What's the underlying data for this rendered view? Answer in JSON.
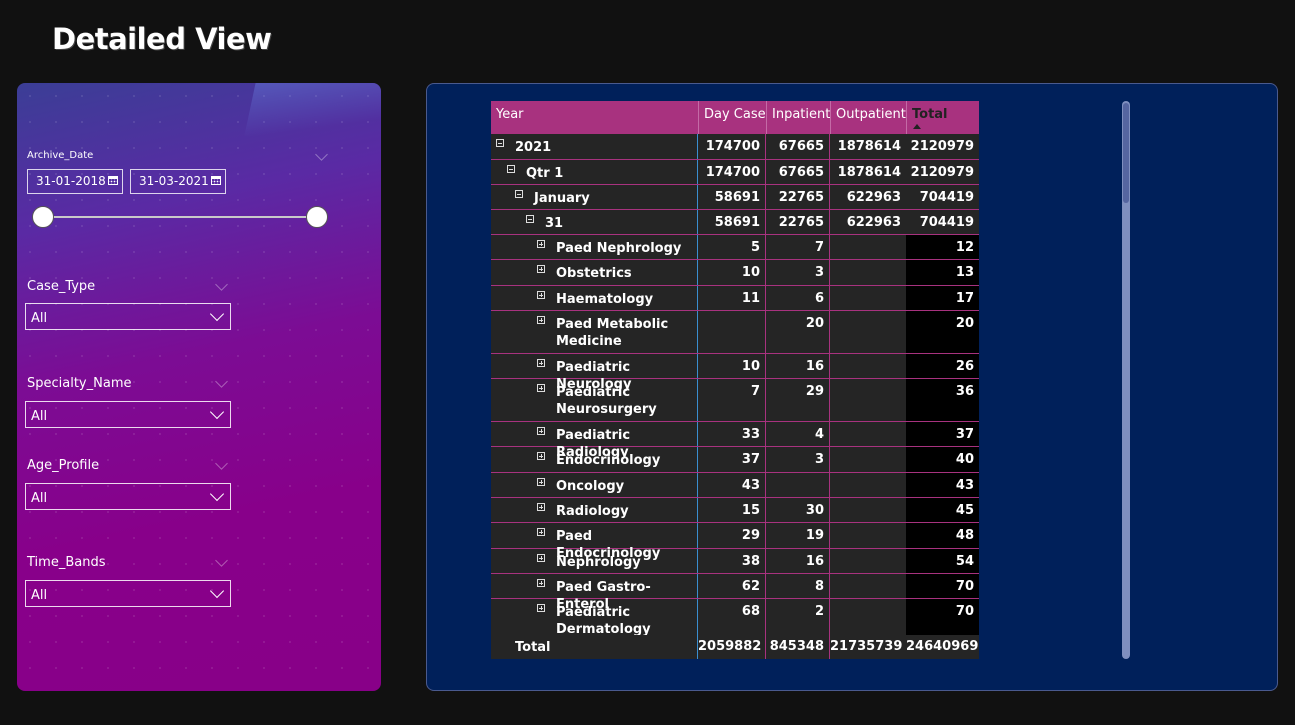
{
  "page": {
    "title": "Detailed View"
  },
  "filters": {
    "archive_date": {
      "label": "Archive_Date",
      "start": "31-01-2018",
      "end": "31-03-2021"
    },
    "dropdowns": [
      {
        "label": "Case_Type",
        "value": "All"
      },
      {
        "label": "Specialty_Name",
        "value": "All"
      },
      {
        "label": "Age_Profile",
        "value": "All"
      },
      {
        "label": "Time_Bands",
        "value": "All"
      }
    ]
  },
  "matrix": {
    "headers": {
      "year": "Year",
      "day_case": "Day Case",
      "inpatient": "Inpatient",
      "outpatient": "Outpatient",
      "total": "Total"
    },
    "rows": [
      {
        "label": "2021",
        "level": 0,
        "expander": "minus",
        "day_case": "174700",
        "inpatient": "67665",
        "outpatient": "1878614",
        "total": "2120979"
      },
      {
        "label": "Qtr 1",
        "level": 1,
        "expander": "minus",
        "day_case": "174700",
        "inpatient": "67665",
        "outpatient": "1878614",
        "total": "2120979"
      },
      {
        "label": "January",
        "level": 2,
        "expander": "minus",
        "day_case": "58691",
        "inpatient": "22765",
        "outpatient": "622963",
        "total": "704419"
      },
      {
        "label": "31",
        "level": 3,
        "expander": "minus",
        "day_case": "58691",
        "inpatient": "22765",
        "outpatient": "622963",
        "total": "704419"
      },
      {
        "label": "Paed Nephrology",
        "level": 4,
        "expander": "plus",
        "day_case": "5",
        "inpatient": "7",
        "outpatient": "",
        "total": "12"
      },
      {
        "label": "Obstetrics",
        "level": 4,
        "expander": "plus",
        "day_case": "10",
        "inpatient": "3",
        "outpatient": "",
        "total": "13"
      },
      {
        "label": "Haematology",
        "level": 4,
        "expander": "plus",
        "day_case": "11",
        "inpatient": "6",
        "outpatient": "",
        "total": "17"
      },
      {
        "label": "Paed Metabolic Medicine",
        "level": 4,
        "expander": "plus",
        "day_case": "",
        "inpatient": "20",
        "outpatient": "",
        "total": "20"
      },
      {
        "label": "Paediatric Neurology",
        "level": 4,
        "expander": "plus",
        "day_case": "10",
        "inpatient": "16",
        "outpatient": "",
        "total": "26"
      },
      {
        "label": "Paediatric Neurosurgery",
        "level": 4,
        "expander": "plus",
        "day_case": "7",
        "inpatient": "29",
        "outpatient": "",
        "total": "36"
      },
      {
        "label": "Paediatric Radiology",
        "level": 4,
        "expander": "plus",
        "day_case": "33",
        "inpatient": "4",
        "outpatient": "",
        "total": "37"
      },
      {
        "label": "Endocrinology",
        "level": 4,
        "expander": "plus",
        "day_case": "37",
        "inpatient": "3",
        "outpatient": "",
        "total": "40"
      },
      {
        "label": "Oncology",
        "level": 4,
        "expander": "plus",
        "day_case": "43",
        "inpatient": "",
        "outpatient": "",
        "total": "43"
      },
      {
        "label": "Radiology",
        "level": 4,
        "expander": "plus",
        "day_case": "15",
        "inpatient": "30",
        "outpatient": "",
        "total": "45"
      },
      {
        "label": "Paed Endocrinology",
        "level": 4,
        "expander": "plus",
        "day_case": "29",
        "inpatient": "19",
        "outpatient": "",
        "total": "48"
      },
      {
        "label": "Nephrology",
        "level": 4,
        "expander": "plus",
        "day_case": "38",
        "inpatient": "16",
        "outpatient": "",
        "total": "54"
      },
      {
        "label": "Paed Gastro-Enterol",
        "level": 4,
        "expander": "plus",
        "day_case": "62",
        "inpatient": "8",
        "outpatient": "",
        "total": "70"
      },
      {
        "label": "Paediatric Dermatology",
        "level": 4,
        "expander": "plus",
        "day_case": "68",
        "inpatient": "2",
        "outpatient": "",
        "total": "70"
      }
    ],
    "grand_total": {
      "label": "Total",
      "day_case": "2059882",
      "inpatient": "845348",
      "outpatient": "21735739",
      "total": "24640969"
    }
  }
}
